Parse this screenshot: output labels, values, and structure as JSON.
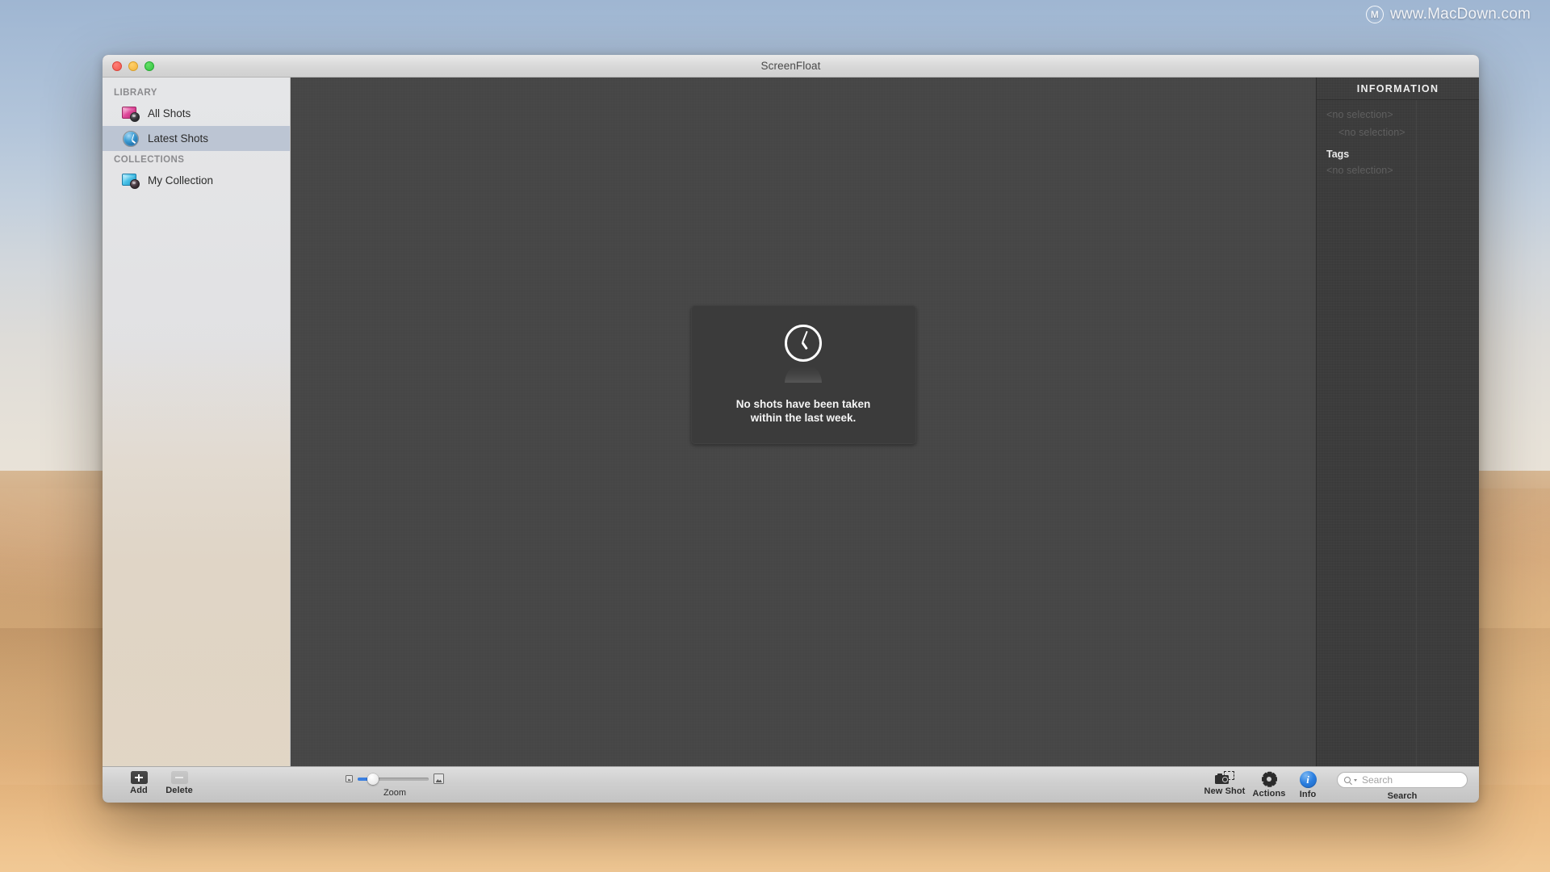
{
  "watermark": {
    "logo_letter": "M",
    "text": "www.MacDown.com"
  },
  "window": {
    "title": "ScreenFloat",
    "traffic_lights": [
      {
        "name": "close",
        "color": "#f1564c"
      },
      {
        "name": "minimize",
        "color": "#f2b43b"
      },
      {
        "name": "zoom",
        "color": "#33c440"
      }
    ]
  },
  "sidebar": {
    "sections": [
      {
        "header": "LIBRARY",
        "items": [
          {
            "label": "All Shots",
            "icon": "photo-album-icon",
            "selected": false
          },
          {
            "label": "Latest Shots",
            "icon": "clock-icon",
            "selected": true
          }
        ]
      },
      {
        "header": "COLLECTIONS",
        "items": [
          {
            "label": "My Collection",
            "icon": "camera-collection-icon",
            "selected": false
          }
        ]
      }
    ]
  },
  "content": {
    "empty_state": {
      "icon": "clock-icon",
      "line1": "No shots have been taken",
      "line2": "within the last week."
    }
  },
  "inspector": {
    "title": "INFORMATION",
    "name_placeholder": "<no selection>",
    "detail_placeholder": "<no selection>",
    "tags_label": "Tags",
    "tags_placeholder": "<no selection>"
  },
  "toolbar": {
    "add_label": "Add",
    "delete_label": "Delete",
    "zoom_label": "Zoom",
    "zoom_value_percent": 22,
    "zoom_min_icon": "small-thumbnail-icon",
    "zoom_max_icon": "large-thumbnail-icon",
    "new_shot_label": "New Shot",
    "actions_label": "Actions",
    "info_label": "Info",
    "search_label": "Search",
    "search_placeholder": "Search",
    "search_value": "",
    "accent_color": "#3b7fe0"
  }
}
